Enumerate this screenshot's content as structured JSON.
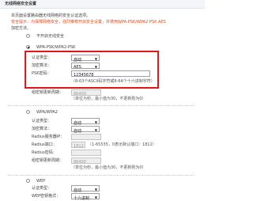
{
  "title": "无线网络安全设置",
  "intro": {
    "line1": "本页面设置路由器无线网络的安全认证选项。",
    "line2": "安全提示：为保障网络安全，强烈推荐开启安全设置，并使用WPA-PSK/WPA2-PSK AES",
    "line3": "加密方法。"
  },
  "options": {
    "none": {
      "label": "不开启无线安全",
      "checked": false
    },
    "wpa_psk": {
      "label": "WPA-PSK/WPA2-PSK",
      "checked": true,
      "auth_type_label": "认证类型：",
      "auth_type_value": "自动",
      "encryption_label": "加密算法：",
      "encryption_value": "AES",
      "psk_label": "PSK密码：",
      "psk_value": "12345678",
      "psk_hint": "（8-63个ASCII码字符或8-64个十六进制字符）",
      "group_key_label": "组密钥更新周期：",
      "group_key_value": "86400",
      "group_key_hint": "（单位为秒，最小值为30，不更新则为0）"
    },
    "wpa": {
      "label": "WPA/WPA2",
      "checked": false,
      "auth_type_label": "认证类型：",
      "auth_type_value": "自动",
      "encryption_label": "加密算法：",
      "encryption_value": "自动",
      "radius_ip_label": "Radius服务器IP：",
      "radius_ip_value": "",
      "radius_port_label": "Radius端口：",
      "radius_port_value": "1812",
      "radius_port_hint": "（1-65535，0表示默认端口：1812）",
      "radius_pwd_label": "Radius密码：",
      "radius_pwd_value": "",
      "group_key_label": "组密钥更新周期：",
      "group_key_value": "86400",
      "group_key_hint": "（单位为秒，最小值为30，不更新则为0）"
    },
    "wep": {
      "label": "WEP",
      "checked": false,
      "auth_type_label": "认证类型：",
      "auth_type_value": "自动",
      "key_format_label": "WEP密钥格式：",
      "key_format_value": "十六进制"
    }
  },
  "colors": {
    "warning": "#e24a1c",
    "highlight_box": "#e3151a"
  }
}
